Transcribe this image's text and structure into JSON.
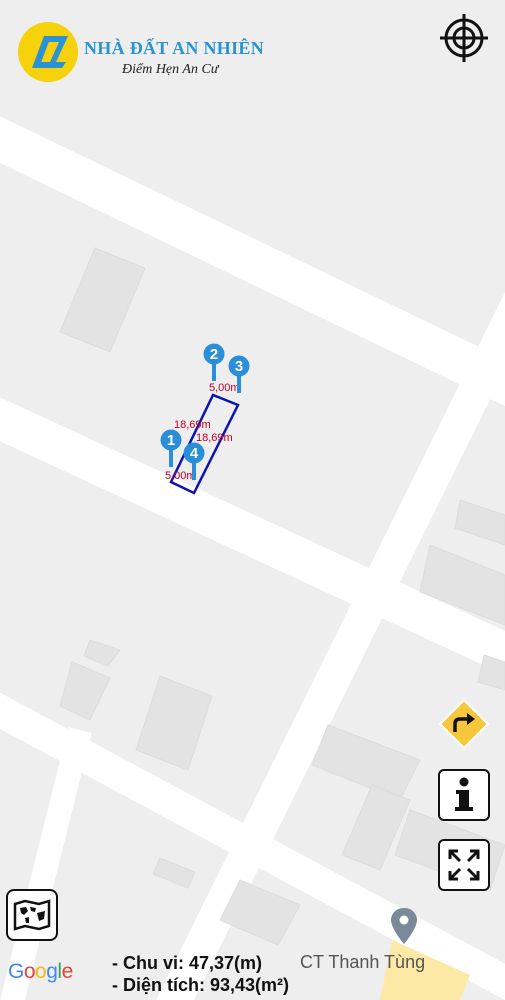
{
  "brand": {
    "title": "NHÀ ĐẤT AN NHIÊN",
    "subtitle": "Điểm Hẹn An Cư"
  },
  "google_logo": [
    "G",
    "o",
    "o",
    "g",
    "l",
    "e"
  ],
  "google_colors": [
    "#4285F4",
    "#EA4335",
    "#FBBC05",
    "#4285F4",
    "#34A853",
    "#EA4335"
  ],
  "parcel": {
    "edges": [
      "5,00m",
      "18,69m",
      "18,69m",
      "5,00m"
    ],
    "markers": [
      "1",
      "2",
      "3",
      "4"
    ],
    "outline_color": "#0a14b4",
    "marker_color": "#2a8fd8",
    "label_color": "#c0002a"
  },
  "info": {
    "perimeter": "- Chu vi: 47,37(m)",
    "area": "- Diện tích: 93,43(m²)"
  },
  "poi": {
    "name": "CT Thanh Tùng",
    "icon": "place-pin-icon"
  },
  "controls": {
    "target_icon": "crosshair-icon",
    "directions_icon": "turn-right-icon",
    "info_icon": "info-icon",
    "expand_icon": "expand-arrows-icon",
    "layers_icon": "world-map-icon"
  }
}
